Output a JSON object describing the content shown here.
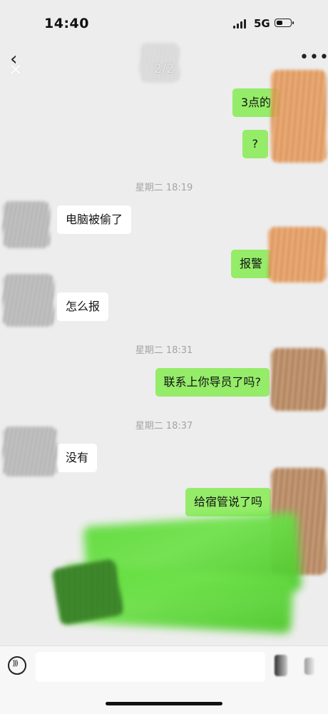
{
  "status_bar": {
    "time": "14:40",
    "network": "5G"
  },
  "header": {
    "page_indicator": "2/2"
  },
  "messages": [
    {
      "side": "right",
      "text": "3点的"
    },
    {
      "side": "right",
      "text": "?"
    },
    {
      "type": "timestamp",
      "text": "星期二 18:19"
    },
    {
      "side": "left",
      "text": "电脑被偷了"
    },
    {
      "side": "right",
      "text": "报警"
    },
    {
      "side": "left",
      "text": "怎么报"
    },
    {
      "type": "timestamp",
      "text": "星期二 18:31"
    },
    {
      "side": "right",
      "text": "联系上你导员了吗?"
    },
    {
      "type": "timestamp",
      "text": "星期二 18:37"
    },
    {
      "side": "left",
      "text": "没有"
    },
    {
      "side": "right",
      "text": "给宿管说了吗"
    }
  ],
  "colors": {
    "my_bubble": "#95ec69",
    "their_bubble": "#ffffff",
    "background": "#ededed"
  },
  "icons": [
    "back-chevron-icon",
    "close-icon",
    "more-icon",
    "voice-icon",
    "emoji-icon",
    "plus-icon"
  ]
}
